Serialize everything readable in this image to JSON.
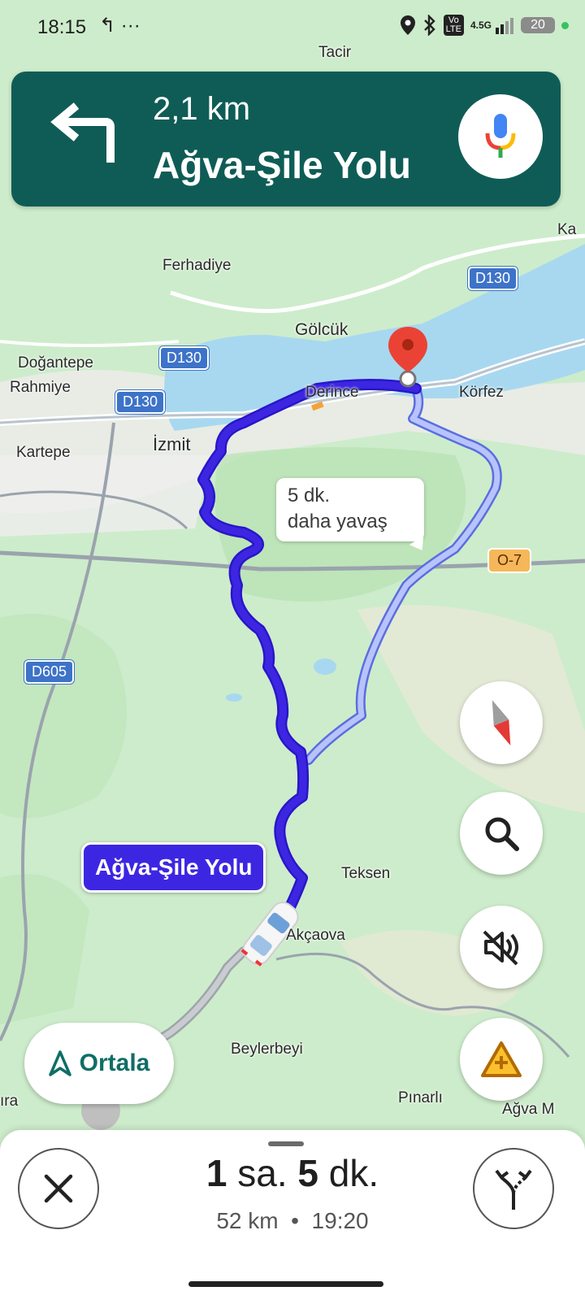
{
  "status_bar": {
    "time": "18:15",
    "extra": "↰ ···",
    "network": "4.5G",
    "battery": "20"
  },
  "navigation": {
    "distance": "2,1 km",
    "street": "Ağva-Şile Yolu",
    "turn_direction": "turn-left",
    "mic_icon": "google-mic-icon"
  },
  "map": {
    "labels": {
      "tacir": "Tacir",
      "ferhadiye": "Ferhadiye",
      "golcuk": "Gölcük",
      "dogantepe": "Doğantepe",
      "rahmiye": "Rahmiye",
      "derince": "Derince",
      "korfez": "Körfez",
      "izmit": "İzmit",
      "kartepe": "Kartepe",
      "teksen": "Teksen",
      "akcaova": "Akçaova",
      "beylerbeyi": "Beylerbeyi",
      "pinarli": "Pınarlı",
      "agva_m": "Ağva M",
      "ira": "ıra",
      "ka": "Ka"
    },
    "shields": {
      "d130_a": "D130",
      "d130_b": "D130",
      "d130_c": "D130",
      "d605": "D605",
      "o7": "O-7"
    },
    "alt_route_callout": {
      "line1": "5 dk.",
      "line2": "daha yavaş"
    },
    "current_road_label": "Ağva-Şile Yolu",
    "route_color": "#3d26e2",
    "alt_route_color": "#a9b6f5"
  },
  "controls": {
    "compass_icon": "compass-icon",
    "search_icon": "search-icon",
    "mute_icon": "sound-off-icon",
    "report_icon": "add-report-icon",
    "recenter_label": "Ortala"
  },
  "trip": {
    "eta_hours": "1",
    "eta_hours_unit": "sa.",
    "eta_minutes": "5",
    "eta_minutes_unit": "dk.",
    "distance": "52 km",
    "separator": "•",
    "arrival": "19:20"
  }
}
